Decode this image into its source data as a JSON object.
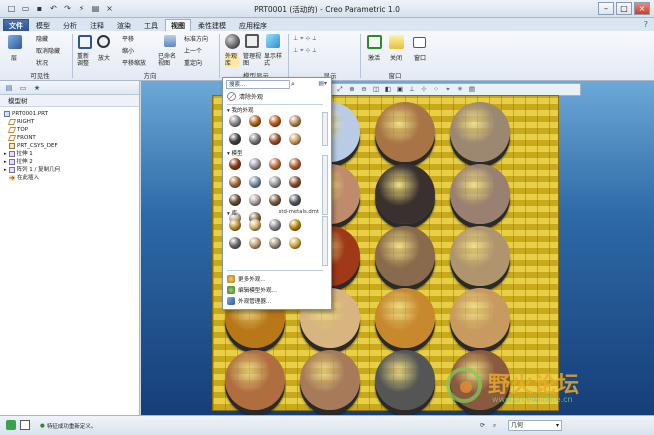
{
  "window": {
    "title": "PRT0001 (活动的) - Creo Parametric 1.0",
    "quick_access": [
      "new-icon",
      "open-icon",
      "save-icon",
      "undo-icon",
      "redo-icon",
      "regenerate-icon",
      "windows-icon",
      "close-icon"
    ]
  },
  "tabs": [
    "文件",
    "模型",
    "分析",
    "注释",
    "渲染",
    "工具",
    "视图",
    "柔性建模",
    "应用程序"
  ],
  "active_tab": "视图",
  "ribbon": {
    "groups": [
      "可见性",
      "方向",
      "模型显示",
      "显示",
      "窗口"
    ],
    "visibility": {
      "layers": "层",
      "hide": "隐藏",
      "unhide": "取消隐藏",
      "status": "状况"
    },
    "orientation": {
      "refit": "重新调整",
      "zoom_in": "放大",
      "pan": "平移",
      "zoom_out": "缩小",
      "pan_zoom": "平移缩放",
      "named_views": "已命名视图",
      "standard": "标准方向",
      "previous": "上一个",
      "reorient": "重定向"
    },
    "model_display": {
      "appearance": "外观库",
      "manage_views": "管理视图",
      "display_style": "显示样式"
    },
    "window": {
      "activate": "激活",
      "close": "关闭",
      "windows": "窗口"
    }
  },
  "left_panel": {
    "header": "模型树",
    "tree": [
      {
        "label": "PRT0001.PRT",
        "icon": "part"
      },
      {
        "label": "RIGHT",
        "icon": "plane"
      },
      {
        "label": "TOP",
        "icon": "plane"
      },
      {
        "label": "FRONT",
        "icon": "plane"
      },
      {
        "label": "PRT_CSYS_DEF",
        "icon": "csys"
      },
      {
        "label": "拉伸 1",
        "icon": "feat"
      },
      {
        "label": "拉伸 2",
        "icon": "feat"
      },
      {
        "label": "阵列 1 / 复制几何",
        "icon": "feat"
      },
      {
        "label": "在此插入",
        "icon": "ins"
      }
    ]
  },
  "appearance_gallery": {
    "search_placeholder": "搜索...",
    "clear": "清除外观",
    "sections": [
      {
        "label": "我的外观"
      },
      {
        "label": "模型"
      },
      {
        "label": "库",
        "source": "std-metals.dmt"
      }
    ],
    "my_appearances": [
      "#8a8a8a",
      "#b5651d",
      "#c45a1a",
      "#b88a5a",
      "#404040",
      "#7a7a7a",
      "#a0522d",
      "#c8a060"
    ],
    "model_appearances": [
      "#8b3a1a",
      "#9a9aa0",
      "#c07040",
      "#b06030",
      "#a86a40",
      "#7a8ea8",
      "#9b9b9b",
      "#8a5030",
      "#6a4a30",
      "#b0a0a0",
      "#7b5a40",
      "#555a60",
      "#c0b0a0",
      "#8a6a50"
    ],
    "library_appearances": [
      "#c09030",
      "#d0b070",
      "#8a8a8a",
      "#b8860b",
      "#6a6a6a",
      "#c0a070",
      "#a09080",
      "#d4a840"
    ],
    "menu": [
      "更多外观...",
      "编辑模型外观...",
      "外观管理器..."
    ]
  },
  "scene": {
    "background": "#2d6aa7",
    "board_color": "#d8b52a",
    "discs": [
      "#7a4a20",
      "#b9cbe6",
      "#a87446",
      "#9c8770",
      "#8a8a8a",
      "#c08b6c",
      "#3a3030",
      "#9a8070",
      "#8a3018",
      "#a0381a",
      "#8a6a4c",
      "#b0946e",
      "#b8781a",
      "#d8b480",
      "#c8882e",
      "#c89a60",
      "#b06e40",
      "#a67a5a",
      "#555555",
      "#8a5a40"
    ]
  },
  "status_bar": {
    "message": "特征成功重新定义。",
    "filter": "几何"
  },
  "watermark": {
    "title": "野火论坛",
    "url": "www.proewildfire.cn"
  }
}
